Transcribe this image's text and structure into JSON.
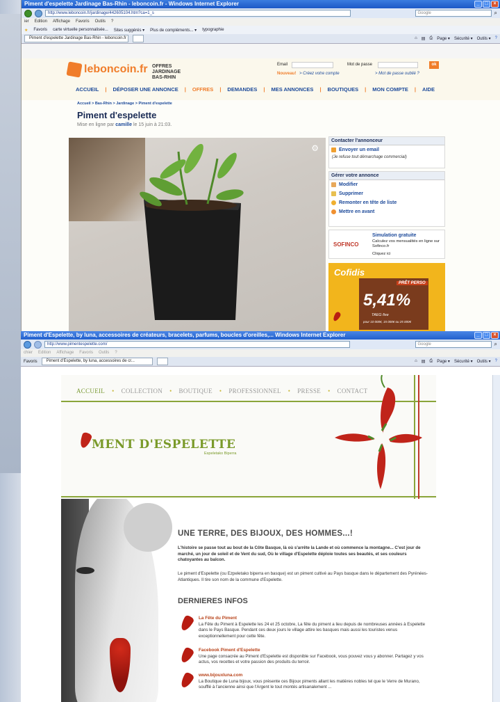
{
  "win1": {
    "title": "Piment d'espelette Jardinage Bas-Rhin - leboncoin.fr - Windows Internet Explorer",
    "url": "http://www.leboncoin.fr/jardinage/442605104.htm?ca=1_s",
    "search_placeholder": "Google",
    "menu": [
      "ier",
      "Edition",
      "Affichage",
      "Favoris",
      "Outils",
      "?"
    ],
    "favorites": [
      "Favoris",
      "carte virtuelle personnalisée...",
      "Sites suggérés ▾",
      "Plus de compléments... ▾",
      "typographie"
    ],
    "tab": "Piment d'espelette Jardinage Bas-Rhin - leboncoin.fr",
    "tools": [
      "Page ▾",
      "Sécurité ▾",
      "Outils ▾"
    ]
  },
  "lbc": {
    "logo": "leboncoin.fr",
    "offer_lines": [
      "OFFRES",
      "JARDINAGE",
      "BAS-RHIN"
    ],
    "email_label": "Email",
    "password_label": "Mot de passe",
    "ok": "ok",
    "nouveau": "Nouveau!",
    "create_account": "> Créez votre compte",
    "forgot": "> Mot de passe oublié ?",
    "nav": [
      "ACCUEIL",
      "DÉPOSER UNE ANNONCE",
      "OFFRES",
      "DEMANDES",
      "MES ANNONCES",
      "BOUTIQUES",
      "MON COMPTE",
      "AIDE"
    ],
    "breadcrumb": "Accueil > Bas-Rhin > Jardinage > Piment d'espelette",
    "ad_title": "Piment d'espelette",
    "posted_prefix": "Mise en ligne par",
    "posted_user": "camille",
    "posted_suffix": "le 15 juin à 21:03.",
    "contact_header": "Contacter l'annonceur",
    "send_email": "Envoyer un email",
    "refuse": "(Je refuse tout démarchage commercial)",
    "manage_header": "Gérer votre annonce",
    "manage_items": [
      "Modifier",
      "Supprimer",
      "Remonter en tête de liste",
      "Mettre en avant"
    ],
    "sofinco_brand": "SOFINCO",
    "sim_title": "Simulation gratuite",
    "sim_text": "Calculez vos mensualités en ligne sur Sofinco.fr",
    "sim_click": "Cliquez ici",
    "cofidis": "Cofidis",
    "pret": "PRÊT PERSO",
    "rate": "5,41%",
    "teg": "TAEG fixe",
    "cond": "pour 10 000€, 15 000€ ou 25 000€"
  },
  "win2": {
    "title": "Piment d'Espelette, by luna, accessoires de créateurs, bracelets, parfums, boucles d'oreilles,... Windows Internet Explorer",
    "url": "http://www.pimentespelette.com/",
    "search_placeholder": "Google",
    "menu": [
      "chier",
      "Edition",
      "Affichage",
      "Favoris",
      "Outils",
      "?"
    ],
    "fav": "Favoris",
    "tab": "Piment d'Espelette, by luna, accessoires de cr...",
    "tools": [
      "Page ▾",
      "Sécurité ▾",
      "Outils ▾"
    ]
  },
  "piment": {
    "nav": [
      "ACCUEIL",
      "COLLECTION",
      "BOUTIQUE",
      "PROFESSIONNEL",
      "PRESSE",
      "CONTACT"
    ],
    "nav_dot": "•",
    "logo": "MENT D'ESPELETTE",
    "logo_sub": "Espeletako Biperra",
    "headline": "UNE TERRE, DES BIJOUX, DES HOMMES...!",
    "intro": "L'histoire se passe tout au bout de la Côte Basque, là où s'arrête la Lande et où commence la montagne... C'est jour de marché, un jour de soleil et de Vent du sud, Où le village d'Espelette déploie toutes ses beautés, et ses couleurs chatoyantes au balcon.",
    "para": "Le piment d'Espelette (ou Ezpeletako biperra en basque) est un piment cultivé au Pays basque dans le département des Pyrénées-Atlantiques. Il tire son nom de la commune d'Espelette.",
    "news_title": "DERNIERES INFOS",
    "news": [
      {
        "title": "La Fête du Piment",
        "text": "La Fête du Piment à Espelette les 24 et 25 octobre, La fête du piment a lieu depuis de nombreuses années à Espelette dans le Pays Basque. Pendant ces deux jours le village attire les basques mais aussi les touristes venus exceptionnellement pour cette fête."
      },
      {
        "title": "Facebook Piment d'Espelette",
        "text": "Une page consacrée au Piment d'Espelette est disponible sur Facebook, vous pouvez vous y abonner. Partagez y vos actus, vos recettes et votre passion des produits du terroir."
      },
      {
        "title": "www.bijouxluna.com",
        "text": "La Boutique de Luna bijoux, vous présente ces Bijoux piments allant les matières nobles tel que le Verre de Murano, soufflé à l'ancienne ainsi que l'Argent le tout montés artisanalement ..."
      }
    ]
  }
}
